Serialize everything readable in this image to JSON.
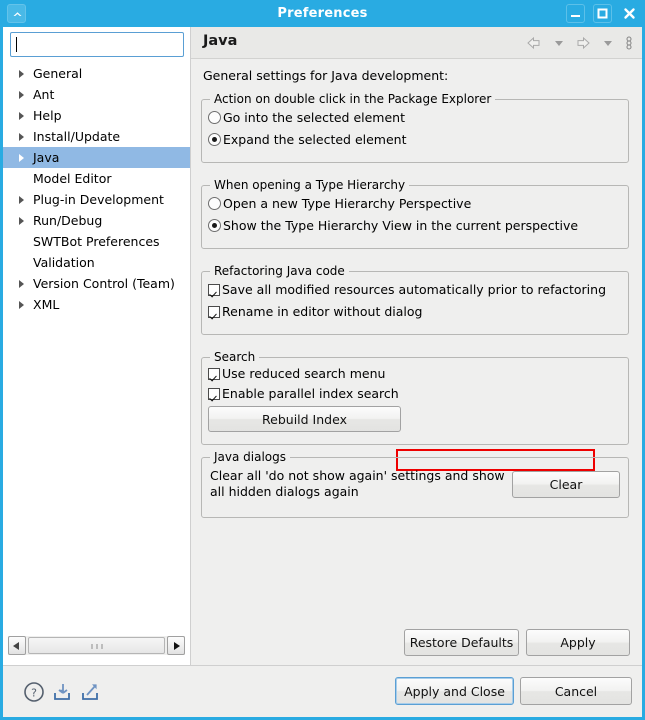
{
  "window": {
    "title": "Preferences",
    "shade_icon": "chevron-up-icon",
    "minimize_label": "–",
    "maximize_label": "□",
    "close_label": "✕"
  },
  "sidebar": {
    "filter": {
      "value": "",
      "placeholder": ""
    },
    "items": [
      {
        "label": "General",
        "expandable": true,
        "selected": false
      },
      {
        "label": "Ant",
        "expandable": true,
        "selected": false
      },
      {
        "label": "Help",
        "expandable": true,
        "selected": false
      },
      {
        "label": "Install/Update",
        "expandable": true,
        "selected": false
      },
      {
        "label": "Java",
        "expandable": true,
        "selected": true
      },
      {
        "label": "Model Editor",
        "expandable": false,
        "selected": false
      },
      {
        "label": "Plug-in Development",
        "expandable": true,
        "selected": false
      },
      {
        "label": "Run/Debug",
        "expandable": true,
        "selected": false
      },
      {
        "label": "SWTBot Preferences",
        "expandable": false,
        "selected": false
      },
      {
        "label": "Validation",
        "expandable": false,
        "selected": false
      },
      {
        "label": "Version Control (Team)",
        "expandable": true,
        "selected": false
      },
      {
        "label": "XML",
        "expandable": true,
        "selected": false
      }
    ],
    "scrollbar": {
      "left_arrow": "scroll-left-icon",
      "right_arrow": "scroll-right-icon"
    }
  },
  "page": {
    "title": "Java",
    "intro": "General settings for Java development:",
    "toolbar": [
      {
        "name": "back-arrow-icon"
      },
      {
        "name": "back-dropdown-icon"
      },
      {
        "name": "forward-arrow-icon"
      },
      {
        "name": "forward-dropdown-icon"
      },
      {
        "name": "view-menu-icon"
      }
    ],
    "groups": {
      "double_click": {
        "title": "Action on double click in the Package Explorer",
        "options": [
          {
            "label": "Go into the selected element",
            "checked": false
          },
          {
            "label": "Expand the selected element",
            "checked": true
          }
        ]
      },
      "type_hierarchy": {
        "title": "When opening a Type Hierarchy",
        "options": [
          {
            "label": "Open a new Type Hierarchy Perspective",
            "checked": false
          },
          {
            "label": "Show the Type Hierarchy View in the current perspective",
            "checked": true
          }
        ]
      },
      "refactoring": {
        "title": "Refactoring Java code",
        "options": [
          {
            "label": "Save all modified resources automatically prior to refactoring",
            "checked": true
          },
          {
            "label": "Rename in editor without dialog",
            "checked": true
          }
        ]
      },
      "search": {
        "title": "Search",
        "options": [
          {
            "label": "Use reduced search menu",
            "checked": true,
            "highlighted": false
          },
          {
            "label": "Enable parallel index search",
            "checked": true,
            "highlighted": true
          }
        ],
        "rebuild_button": "Rebuild Index",
        "highlight_color": "#ee0000"
      },
      "java_dialogs": {
        "title": "Java dialogs",
        "description_line1": "Clear all 'do not show again' settings and show",
        "description_line2": "all hidden dialogs again",
        "clear_button": "Clear"
      }
    },
    "page_buttons": {
      "restore_defaults": "Restore Defaults",
      "apply": "Apply"
    }
  },
  "footer": {
    "icons": [
      {
        "name": "help-icon"
      },
      {
        "name": "import-icon"
      },
      {
        "name": "export-icon"
      }
    ],
    "apply_and_close": "Apply and Close",
    "cancel": "Cancel"
  },
  "colors": {
    "titlebar": "#29abe2",
    "selection": "#90b9e4",
    "panel": "#efefee",
    "highlight": "#ee0000"
  }
}
